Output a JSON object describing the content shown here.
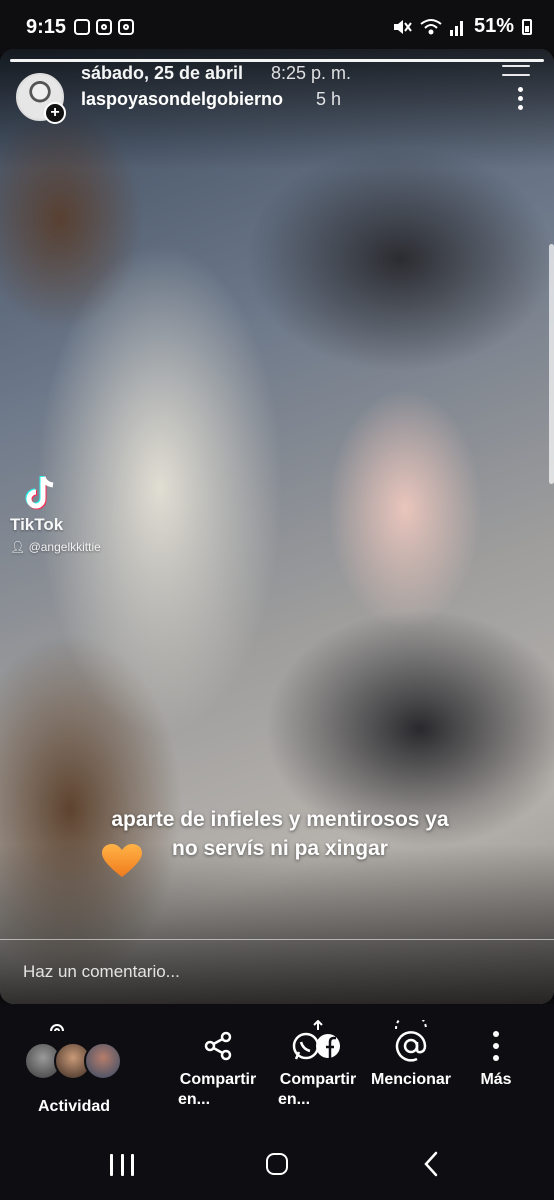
{
  "status_bar": {
    "time": "9:15",
    "battery": "51%",
    "left_icons": [
      "gallery-icon",
      "instagram-icon",
      "instagram-icon"
    ],
    "right_icons": [
      "mute-icon",
      "wifi-icon",
      "signal-icon",
      "battery-icon"
    ]
  },
  "story": {
    "date": "sábado, 25 de abril",
    "time": "8:25 p. m.",
    "username": "laspoyasondelgobierno",
    "age": "5 h",
    "progress": 1.0,
    "tiktok": {
      "brand": "TikTok",
      "handle": "@angelkkittie"
    },
    "caption_line1": "aparte de infieles y mentirosos ya",
    "caption_line2": "no servís ni pa xingar",
    "comment_placeholder": "Haz un comentario..."
  },
  "bottom_bar": {
    "activity_label": "Actividad",
    "actions": [
      {
        "label_line1": "Compartir",
        "label_line2": "en...",
        "icon": "share-icon"
      },
      {
        "label_line1": "Compartir",
        "label_line2": "en...",
        "icon": "whatsapp-facebook-icon"
      },
      {
        "label_line1": "Mencionar",
        "label_line2": "",
        "icon": "at-mention-icon"
      },
      {
        "label_line1": "Más",
        "label_line2": "",
        "icon": "more-vertical-icon"
      }
    ]
  },
  "nav_bar": {
    "buttons": [
      "recents-button",
      "home-button",
      "back-button"
    ]
  }
}
